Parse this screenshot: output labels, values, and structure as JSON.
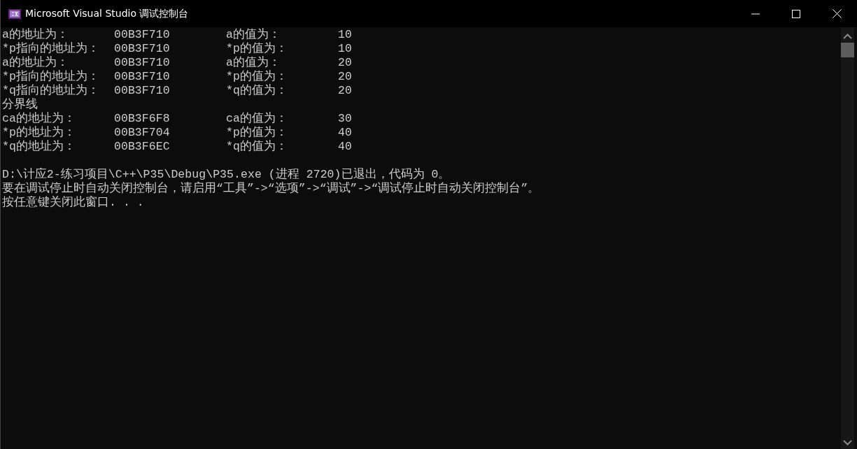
{
  "window": {
    "title": "Microsoft Visual Studio 调试控制台"
  },
  "lines": [
    {
      "kind": "pair",
      "address_label": "a的地址为：",
      "address": "00B3F710",
      "value_label": "a的值为：",
      "value": "10"
    },
    {
      "kind": "pair",
      "address_label": "*p指向的地址为：",
      "address": "00B3F710",
      "value_label": "*p的值为：",
      "value": "10"
    },
    {
      "kind": "pair",
      "address_label": "a的地址为：",
      "address": "00B3F710",
      "value_label": "a的值为：",
      "value": "20"
    },
    {
      "kind": "pair",
      "address_label": "*p指向的地址为：",
      "address": "00B3F710",
      "value_label": "*p的值为：",
      "value": "20"
    },
    {
      "kind": "pair",
      "address_label": "*q指向的地址为：",
      "address": "00B3F710",
      "value_label": "*q的值为：",
      "value": "20"
    },
    {
      "kind": "text",
      "text": "分界线"
    },
    {
      "kind": "pair",
      "address_label": "ca的地址为：",
      "address": "00B3F6F8",
      "value_label": "ca的值为：",
      "value": "30"
    },
    {
      "kind": "pair",
      "address_label": "*p的地址为：",
      "address": "00B3F704",
      "value_label": "*p的值为：",
      "value": "40"
    },
    {
      "kind": "pair",
      "address_label": "*q的地址为：",
      "address": "00B3F6EC",
      "value_label": "*q的值为：",
      "value": "40"
    },
    {
      "kind": "blank"
    },
    {
      "kind": "text",
      "text": "D:\\计应2-练习项目\\C++\\P35\\Debug\\P35.exe (进程 2720)已退出，代码为 0。"
    },
    {
      "kind": "text",
      "text": "要在调试停止时自动关闭控制台，请启用“工具”->“选项”->“调试”->“调试停止时自动关闭控制台”。"
    },
    {
      "kind": "text",
      "text": "按任意键关闭此窗口. . ."
    }
  ]
}
